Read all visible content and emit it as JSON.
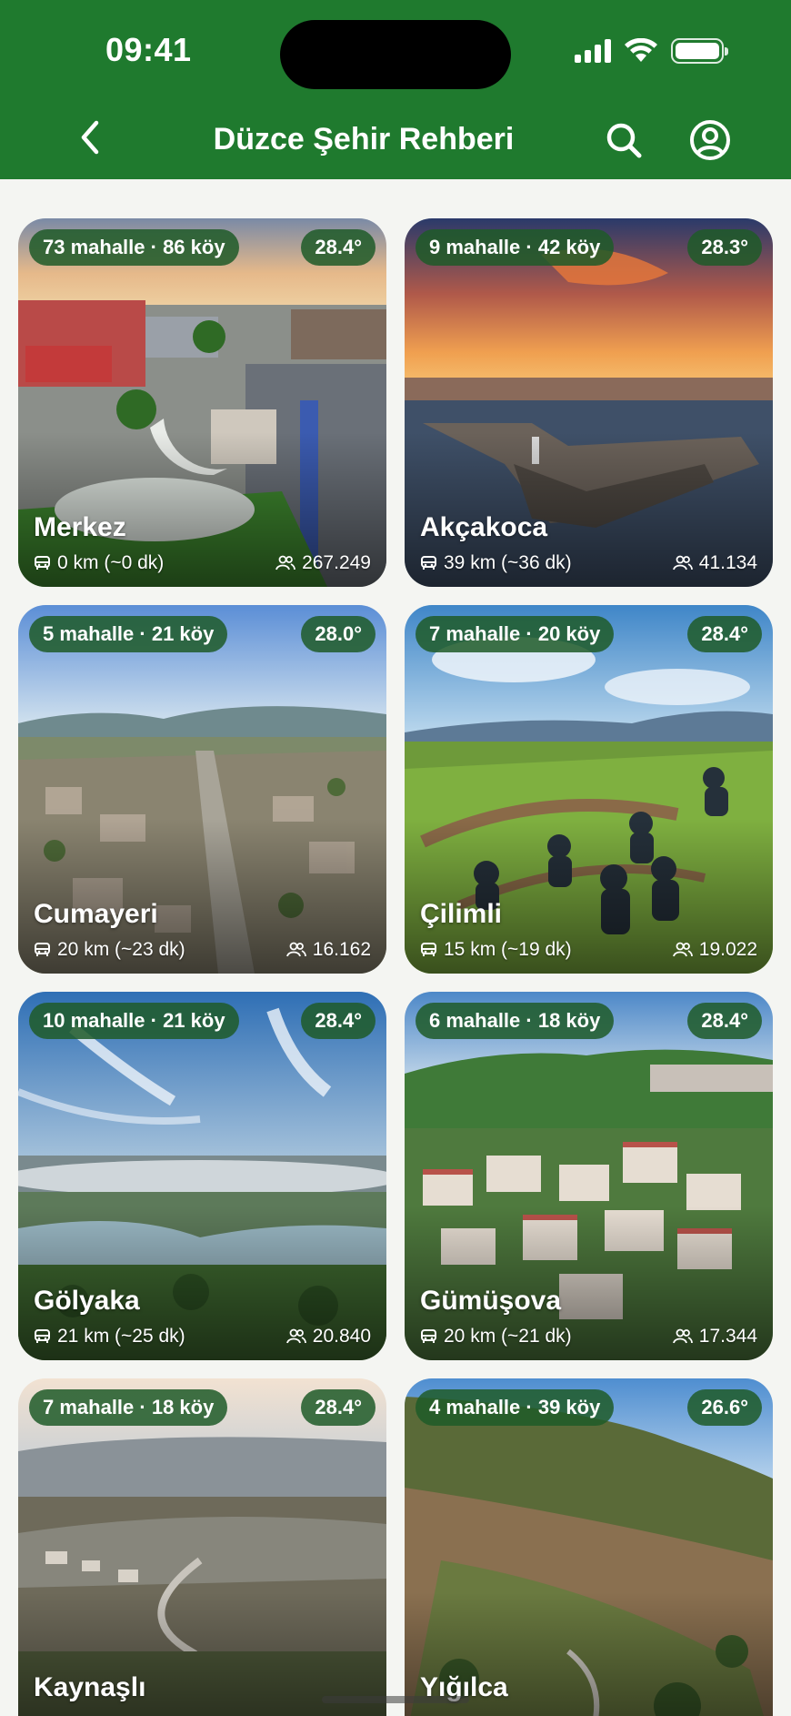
{
  "status_bar": {
    "time": "09:41"
  },
  "nav": {
    "title": "Düzce Şehir Rehberi"
  },
  "districts": [
    {
      "name": "Merkez",
      "counts": "73 mahalle · 86 köy",
      "temperature": "28.4°",
      "distance": "0 km (~0 dk)",
      "population": "267.249"
    },
    {
      "name": "Akçakoca",
      "counts": "9 mahalle · 42 köy",
      "temperature": "28.3°",
      "distance": "39 km (~36 dk)",
      "population": "41.134"
    },
    {
      "name": "Cumayeri",
      "counts": "5 mahalle · 21 köy",
      "temperature": "28.0°",
      "distance": "20 km (~23 dk)",
      "population": "16.162"
    },
    {
      "name": "Çilimli",
      "counts": "7 mahalle · 20 köy",
      "temperature": "28.4°",
      "distance": "15 km (~19 dk)",
      "population": "19.022"
    },
    {
      "name": "Gölyaka",
      "counts": "10 mahalle · 21 köy",
      "temperature": "28.4°",
      "distance": "21 km (~25 dk)",
      "population": "20.840"
    },
    {
      "name": "Gümüşova",
      "counts": "6 mahalle · 18 köy",
      "temperature": "28.4°",
      "distance": "20 km (~21 dk)",
      "population": "17.344"
    },
    {
      "name": "Kaynaşlı",
      "counts": "7 mahalle · 18 köy",
      "temperature": "28.4°",
      "distance": "",
      "population": ""
    },
    {
      "name": "Yığılca",
      "counts": "4 mahalle · 39 köy",
      "temperature": "26.6°",
      "distance": "",
      "population": ""
    }
  ],
  "colors": {
    "brand_green": "#1f7a2e",
    "badge_green": "#1e5a28",
    "background": "#f4f5f2"
  },
  "icons": {
    "back": "chevron-left-icon",
    "search": "search-icon",
    "profile": "user-circle-icon",
    "distance": "car-icon",
    "population": "people-icon"
  }
}
